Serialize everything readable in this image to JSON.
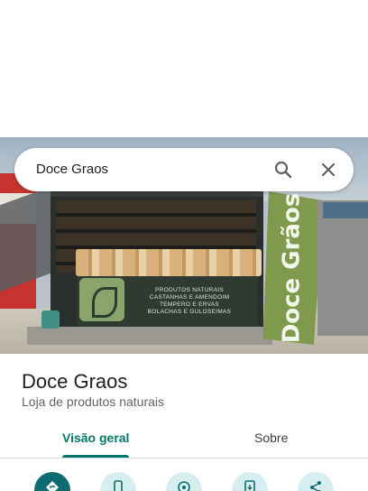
{
  "search": {
    "query": "Doce Graos"
  },
  "photo": {
    "signboard_lines": [
      "PRODUTOS NATURAIS",
      "CASTANHAS E AMENDOIM",
      "TEMPERO E ERVAS",
      "BOLACHAS E GULOSEIMAS"
    ],
    "banner_text": "Doce Grãos"
  },
  "place": {
    "title": "Doce Graos",
    "category": "Loja de produtos naturais"
  },
  "tabs": [
    {
      "label": "Visão geral",
      "selected": true
    },
    {
      "label": "Sobre",
      "selected": false
    }
  ],
  "actions": [
    {
      "icon": "directions-icon"
    },
    {
      "icon": "phone-icon"
    },
    {
      "icon": "location-icon"
    },
    {
      "icon": "save-to-phone-icon"
    },
    {
      "icon": "share-icon"
    }
  ],
  "colors": {
    "accent": "#00796b",
    "primary_action": "#0f6b72",
    "action_bg": "#d7eef0"
  }
}
